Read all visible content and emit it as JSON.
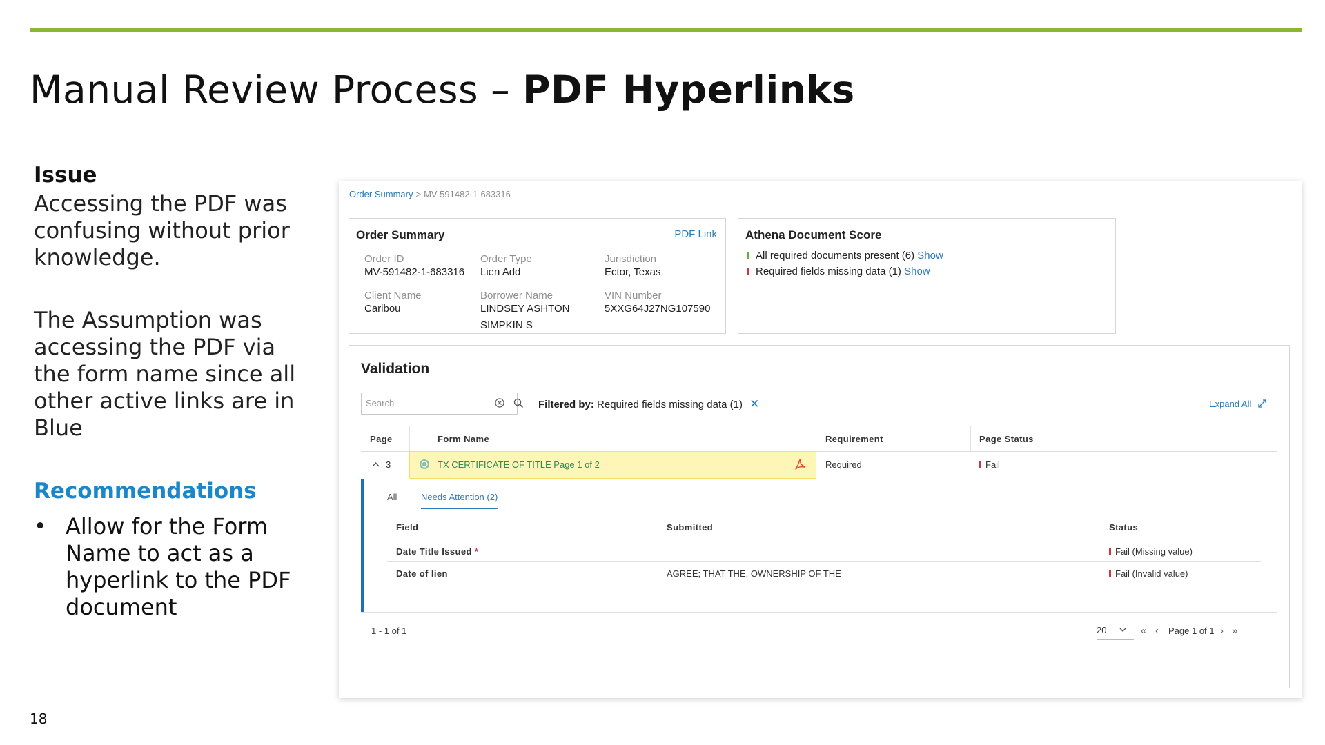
{
  "slide": {
    "title_light": "Manual Review Process – ",
    "title_bold": "PDF Hyperlinks",
    "page_number": "18",
    "accent_color": "#8ab833"
  },
  "left": {
    "issue_heading": "Issue",
    "issue_text": "Accessing the PDF was confusing without prior knowledge.",
    "assumption_text": "The Assumption was accessing the PDF via the form name since all other active links are in Blue",
    "rec_heading": "Recommendations",
    "bullets": [
      "Allow for the Form Name to act as a hyperlink to the PDF document"
    ]
  },
  "screenshot": {
    "breadcrumb": {
      "root": "Order Summary",
      "separator": ">",
      "current": "MV-591482-1-683316"
    },
    "order_summary": {
      "title": "Order Summary",
      "pdf_link": "PDF Link",
      "fields": [
        {
          "label": "Order ID",
          "value": "MV-591482-1-683316"
        },
        {
          "label": "Order Type",
          "value": "Lien Add"
        },
        {
          "label": "Jurisdiction",
          "value": "Ector, Texas"
        },
        {
          "label": "Client Name",
          "value": "Caribou"
        },
        {
          "label": "Borrower Name",
          "value": "LINDSEY ASHTON SIMPKIN S"
        },
        {
          "label": "VIN Number",
          "value": "5XXG64J27NG107590"
        }
      ]
    },
    "athena": {
      "title": "Athena Document Score",
      "rows": [
        {
          "text": "All required documents present (6)",
          "action": "Show",
          "status_color": "#5fb234"
        },
        {
          "text": "Required fields missing data (1)",
          "action": "Show",
          "status_color": "#d8323c"
        }
      ]
    },
    "validation": {
      "title": "Validation",
      "search_placeholder": "Search",
      "filter_label": "Filtered by:",
      "filter_value": "Required fields missing data (1)",
      "filter_clear": "✕",
      "expand_all": "Expand All",
      "columns": [
        "Page",
        "Form Name",
        "Requirement",
        "Page Status"
      ],
      "row": {
        "page": "3",
        "form_name": "TX CERTIFICATE OF TITLE Page 1 of 2",
        "requirement": "Required",
        "status": "Fail"
      },
      "subtabs": {
        "all": "All",
        "needs": "Needs Attention (2)"
      },
      "sub_columns": [
        "Field",
        "Submitted",
        "Status"
      ],
      "sub_rows": [
        {
          "field": "Date Title Issued",
          "required_mark": "*",
          "submitted": "",
          "status": "Fail (Missing value)"
        },
        {
          "field": "Date of lien",
          "required_mark": "",
          "submitted": "AGREE; THAT THE, OWNERSHIP OF THE",
          "status": "Fail (Invalid value)"
        }
      ],
      "pager": {
        "count": "1 - 1 of 1",
        "page_size": "20",
        "first": "«",
        "prev": "‹",
        "label": "Page 1 of 1",
        "next": "›",
        "last": "»"
      }
    }
  }
}
